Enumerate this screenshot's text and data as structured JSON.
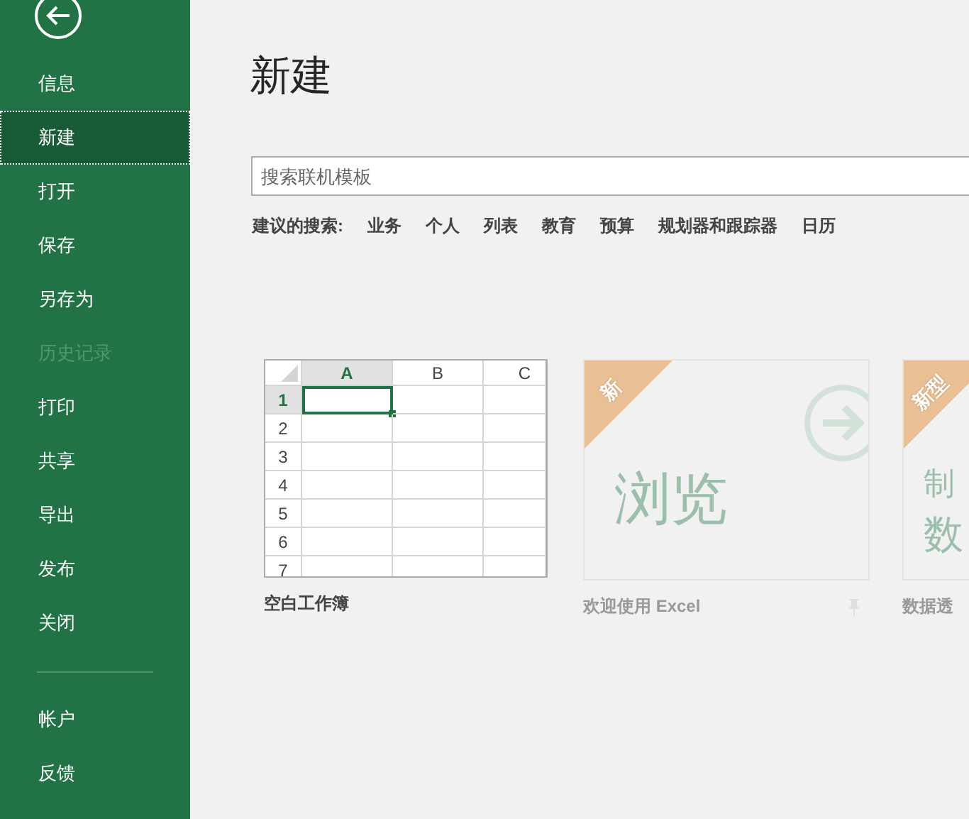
{
  "sidebar": {
    "items": [
      {
        "label": "信息",
        "selected": false,
        "disabled": false
      },
      {
        "label": "新建",
        "selected": true,
        "disabled": false
      },
      {
        "label": "打开",
        "selected": false,
        "disabled": false
      },
      {
        "label": "保存",
        "selected": false,
        "disabled": false
      },
      {
        "label": "另存为",
        "selected": false,
        "disabled": false
      },
      {
        "label": "历史记录",
        "selected": false,
        "disabled": true
      },
      {
        "label": "打印",
        "selected": false,
        "disabled": false
      },
      {
        "label": "共享",
        "selected": false,
        "disabled": false
      },
      {
        "label": "导出",
        "selected": false,
        "disabled": false
      },
      {
        "label": "发布",
        "selected": false,
        "disabled": false
      },
      {
        "label": "关闭",
        "selected": false,
        "disabled": false
      }
    ],
    "bottom_items": [
      {
        "label": "帐户",
        "selected": false,
        "disabled": false
      },
      {
        "label": "反馈",
        "selected": false,
        "disabled": false
      }
    ]
  },
  "page_title": "新建",
  "search": {
    "placeholder": "搜索联机模板"
  },
  "suggested_searches": {
    "label": "建议的搜索:",
    "links": [
      "业务",
      "个人",
      "列表",
      "教育",
      "预算",
      "规划器和跟踪器",
      "日历"
    ]
  },
  "templates": [
    {
      "kind": "blank",
      "caption": "空白工作簿",
      "sheet": {
        "columns": [
          {
            "label": "A",
            "selected": true
          },
          {
            "label": "B",
            "selected": false
          },
          {
            "label": "C",
            "selected": false
          }
        ],
        "rows": [
          {
            "label": "1",
            "selected": true
          },
          {
            "label": "2",
            "selected": false
          },
          {
            "label": "3",
            "selected": false
          },
          {
            "label": "4",
            "selected": false
          },
          {
            "label": "5",
            "selected": false
          },
          {
            "label": "6",
            "selected": false
          },
          {
            "label": "7",
            "selected": false
          }
        ]
      }
    },
    {
      "kind": "tour",
      "badge": "新",
      "title": "浏览",
      "caption": "欢迎使用 Excel"
    },
    {
      "kind": "feature",
      "badge": "新型",
      "lines": [
        "制",
        "数"
      ],
      "caption": "数据透"
    }
  ]
}
